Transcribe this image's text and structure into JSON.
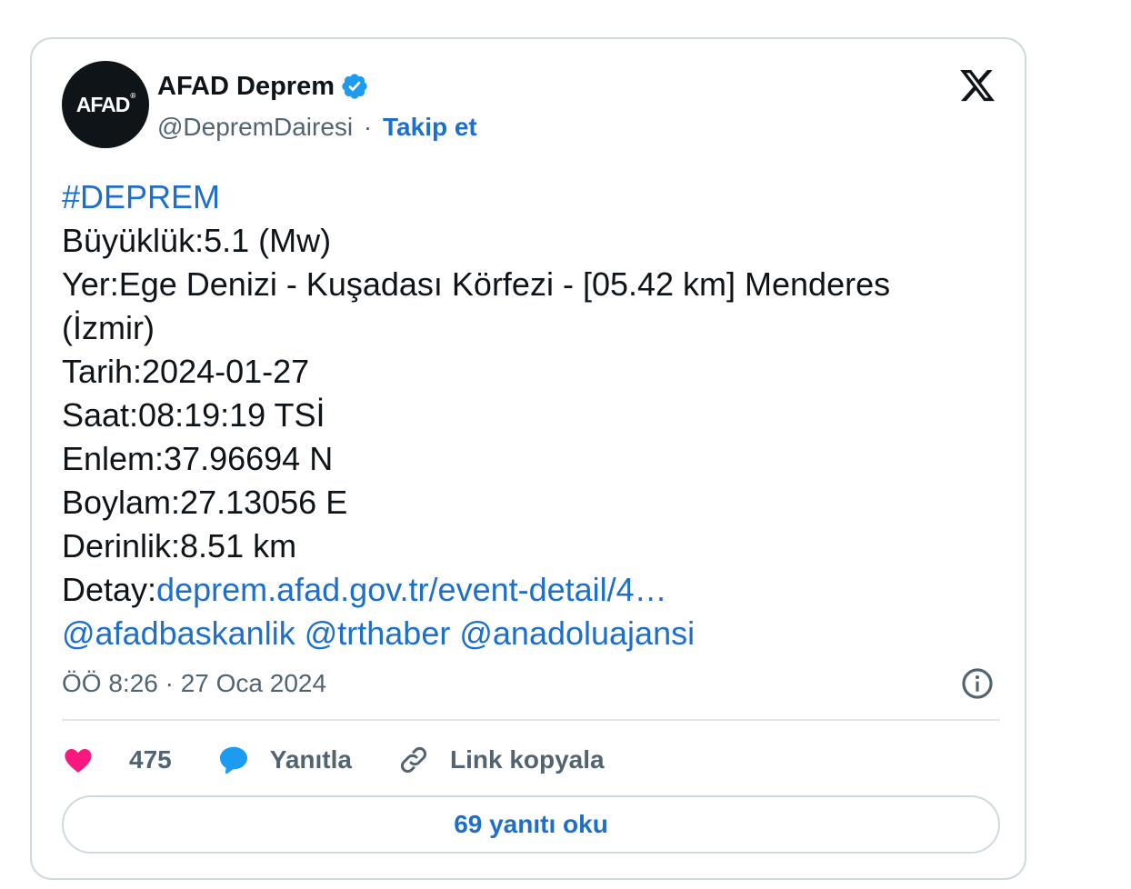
{
  "author": {
    "avatar_text": "AFAD",
    "avatar_mark": "®",
    "display_name": "AFAD Deprem",
    "handle": "@DepremDairesi",
    "separator": "·",
    "follow_label": "Takip et",
    "verified": true
  },
  "tweet": {
    "hashtag": "#DEPREM",
    "lines": {
      "magnitude": "Büyüklük:5.1 (Mw)",
      "location": "Yer:Ege Denizi - Kuşadası Körfezi - [05.42 km] Menderes (İzmir)",
      "date": "Tarih:2024-01-27",
      "time": "Saat:08:19:19 TSİ",
      "latitude": "Enlem:37.96694 N",
      "longitude": "Boylam:27.13056 E",
      "depth": "Derinlik:8.51 km"
    },
    "detail_label": "Detay:",
    "detail_link": "deprem.afad.gov.tr/event-detail/4…",
    "mentions": [
      "@afadbaskanlik",
      "@trthaber",
      "@anadoluajansi"
    ]
  },
  "meta": {
    "timestamp": "ÖÖ 8:26 · 27 Oca 2024"
  },
  "actions": {
    "likes_count": "475",
    "reply_label": "Yanıtla",
    "copy_link_label": "Link kopyala"
  },
  "read_replies_label": "69 yanıtı oku",
  "colors": {
    "link": "#1d6fc9",
    "like": "#f91880",
    "reply": "#1d9bf0",
    "verified": "#1d9bf0",
    "border": "#cfd9de",
    "muted": "#536471"
  },
  "icons": [
    "verified-badge-icon",
    "x-logo-icon",
    "info-icon",
    "heart-icon",
    "reply-bubble-icon",
    "link-icon"
  ]
}
